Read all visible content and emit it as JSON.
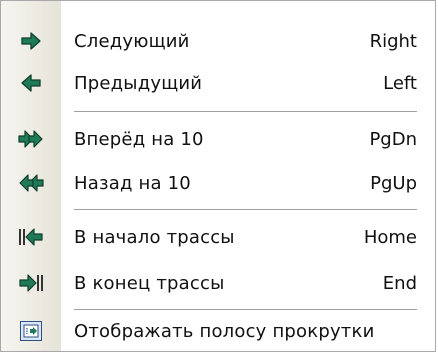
{
  "menu": {
    "items": [
      {
        "label": "Следующий",
        "shortcut": "Right",
        "icon": "arrow-right-icon"
      },
      {
        "label": "Предыдущий",
        "shortcut": "Left",
        "icon": "arrow-left-icon"
      },
      {
        "label": "Вперёд на 10",
        "shortcut": "PgDn",
        "icon": "double-arrow-right-icon"
      },
      {
        "label": "Назад на 10",
        "shortcut": "PgUp",
        "icon": "double-arrow-left-icon"
      },
      {
        "label": "В начало трассы",
        "shortcut": "Home",
        "icon": "go-to-start-icon"
      },
      {
        "label": "В конец трассы",
        "shortcut": "End",
        "icon": "go-to-end-icon"
      },
      {
        "label": "Отображать полосу прокрутки",
        "shortcut": "",
        "icon": "scrollbar-checkbox-icon",
        "checked": true
      }
    ],
    "colors": {
      "arrow": "#1f7a58",
      "arrow_outline": "#0f3f2c",
      "gutter": "#ece9df"
    }
  }
}
